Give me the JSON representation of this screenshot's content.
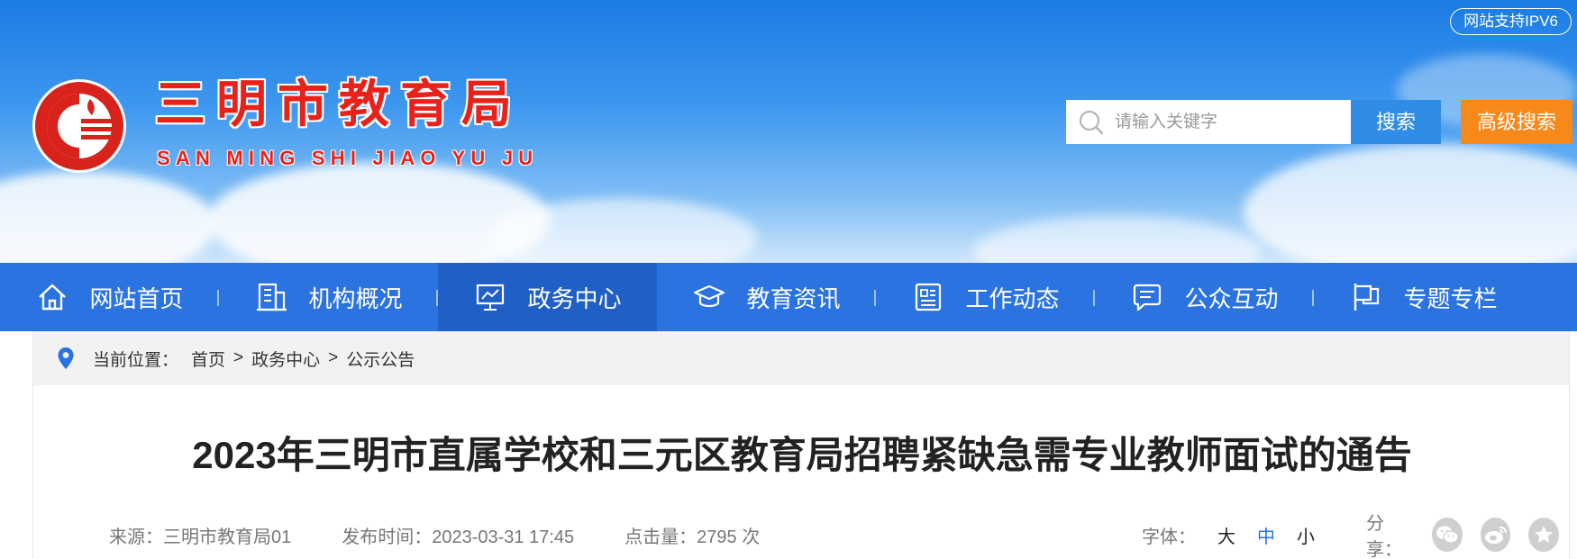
{
  "header": {
    "ipv6_badge": "网站支持IPV6",
    "site_title": "三明市教育局",
    "site_subtitle": "SAN MING SHI JIAO YU JU",
    "search": {
      "placeholder": "请输入关键字",
      "button_label": "搜索",
      "advanced_label": "高级搜索"
    },
    "colors": {
      "title_red": "#e8221b",
      "search_blue": "#2f8de6",
      "advanced_orange": "#f7891a"
    }
  },
  "nav": {
    "items": [
      {
        "label": "网站首页",
        "icon": "home-icon"
      },
      {
        "label": "机构概况",
        "icon": "building-icon"
      },
      {
        "label": "政务中心",
        "icon": "presentation-icon",
        "active": true
      },
      {
        "label": "教育资讯",
        "icon": "graduation-cap-icon"
      },
      {
        "label": "工作动态",
        "icon": "document-icon"
      },
      {
        "label": "公众互动",
        "icon": "chat-icon"
      },
      {
        "label": "专题专栏",
        "icon": "flag-icon"
      }
    ],
    "colors": {
      "bar": "#2a73e0",
      "active": "#1f5fc6"
    }
  },
  "breadcrumb": {
    "prefix": "当前位置：",
    "items": [
      "首页",
      "政务中心",
      "公示公告"
    ],
    "separator": ">"
  },
  "article": {
    "title": "2023年三明市直属学校和三元区教育局招聘紧缺急需专业教师面试的通告",
    "source": "来源：三明市教育局01",
    "publish_time": "发布时间：2023-03-31 17:45",
    "hits": "点击量：2795 次",
    "font_size_label": "字体：",
    "font_size_options": [
      "大",
      "中",
      "小"
    ],
    "font_size_active": "中",
    "share_label": "分享：",
    "share_icons": [
      "wechat-icon",
      "weibo-icon",
      "favorite-icon"
    ]
  }
}
